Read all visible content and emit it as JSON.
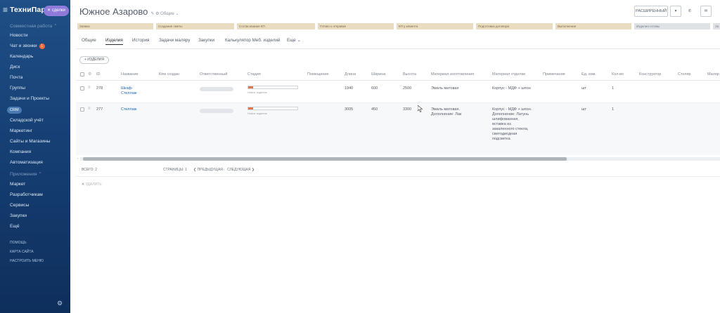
{
  "sidebar": {
    "brand": "ТехниПарк",
    "tag": "сделки",
    "items": [
      {
        "label": "Совместная работа ⌃",
        "muted": true
      },
      {
        "label": "Новости"
      },
      {
        "label": "Чат и звонки",
        "badge": "1"
      },
      {
        "label": "Календарь"
      },
      {
        "label": "Диск"
      },
      {
        "label": "Почта"
      },
      {
        "label": "Группы"
      },
      {
        "label": "Задачи и Проекты"
      },
      {
        "label": "CRM",
        "pill": true
      },
      {
        "label": "Складской учёт"
      },
      {
        "label": "Маркетинг"
      },
      {
        "label": "Сайты и Магазины"
      },
      {
        "label": "Компания"
      },
      {
        "label": "Автоматизация"
      },
      {
        "label": "Приложения ⌃",
        "muted": true
      },
      {
        "label": "Маркет"
      },
      {
        "label": "Разработчикам"
      },
      {
        "label": "Сервисы"
      },
      {
        "label": "Закупки"
      },
      {
        "label": "Ещё"
      }
    ],
    "footer": [
      "ПОМОЩЬ",
      "КАРТА САЙТА",
      "НАСТРОИТЬ МЕНЮ"
    ]
  },
  "header": {
    "title": "Южное Азарово",
    "title_extra": "✎ ⚙ Общие ⌄",
    "btn_expand": "РАСШИРЕННЫЙ",
    "btn_dropdown": "▾",
    "phone_icon": "✆",
    "mail_icon": "✉"
  },
  "stages": [
    "Заявка",
    "Создание сметы",
    "Согласование КП",
    "Готово к отправке",
    "КП у клиента",
    "Подготовка договора",
    "Выполнение",
    "Изделия готовы",
    "За"
  ],
  "tabs": [
    "Общие",
    "Изделия",
    "История",
    "Задачи маляру",
    "Закупки",
    "Калькулятор Меб. изделий",
    "Еще ⌄"
  ],
  "active_tab": "Изделия",
  "add_button": "+ ИЗДЕЛИЯ",
  "columns": [
    "ID",
    "Название",
    "Кем создан",
    "Ответственный",
    "Стадия",
    "Помещение",
    "Длина",
    "Ширина",
    "Высота",
    "Материал изготовления",
    "Материал отделки",
    "Примечание",
    "Ед. изм.",
    "Кол-во",
    "Конструктор",
    "Столяр",
    "Маляр"
  ],
  "rows": [
    {
      "id": "278",
      "name": "Шкаф-Стеллаж",
      "stage_label": "Новое изделие",
      "stage_progress": 0.1,
      "length": "1940",
      "width": "600",
      "height": "2500",
      "material": "Эмаль матовая",
      "finish": "Корпус - МДФ + шпон",
      "unit": "шт",
      "qty": "1"
    },
    {
      "id": "277",
      "name": "Стеллаж",
      "stage_label": "Новое изделие",
      "stage_progress": 0.1,
      "length": "3005",
      "width": "450",
      "height": "3300",
      "material": "Эмаль матовая. Дополнение: Лак",
      "finish": "Корпус - МДФ + шпон. Дополнение: Латунь шлифованная, вставка из закаленного стекла, светодиодная подсветка",
      "unit": "шт",
      "qty": "1"
    }
  ],
  "footer": {
    "total": "ВСЕГО: 2",
    "pages": "СТРАНИЦЫ: 1",
    "prev": "❮ ПРЕДЫДУЩАЯ",
    "next": "СЛЕДУЮЩАЯ ❯",
    "delete": "✖ УДАЛИТЬ"
  },
  "colors": {
    "sidebar": "#1f4f86",
    "stage": "#e9dcc0",
    "progress": "#e8734a",
    "link": "#2067b0"
  }
}
